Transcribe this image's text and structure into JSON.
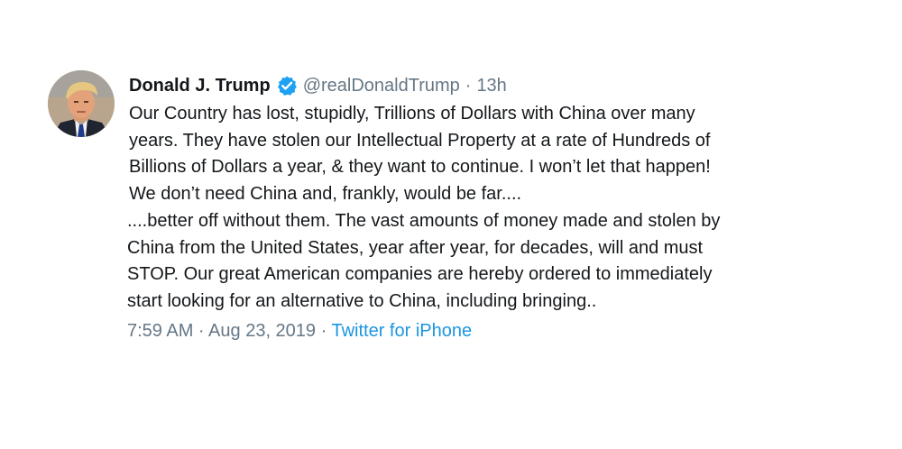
{
  "tweet": {
    "author_name": "Donald J. Trump",
    "handle": "@realDonaldTrump",
    "separator": "·",
    "relative_time": "13h",
    "text_part1_lines": [
      "Our Country has lost, stupidly, Trillions of Dollars with China over many",
      "years. They have stolen our Intellectual Property at a rate of Hundreds of",
      "Billions of Dollars a year, & they want to continue. I won’t let that happen!",
      "We don’t need China and, frankly, would be far...."
    ],
    "text_part2_lines": [
      "....better off without them. The vast amounts of money made and stolen by",
      "China from the United States, year after year, for decades, will and must",
      "STOP. Our great American companies are hereby ordered to immediately",
      "start looking for an alternative to China, including bringing.."
    ],
    "timestamp": "7:59 AM · Aug 23, 2019 · ",
    "source": "Twitter for iPhone"
  },
  "colors": {
    "text": "#14171a",
    "secondary": "#657786",
    "accent": "#1b95e0",
    "verified": "#1da1f2"
  },
  "icons": {
    "verified": "verified-badge-icon",
    "avatar": "profile-avatar"
  }
}
